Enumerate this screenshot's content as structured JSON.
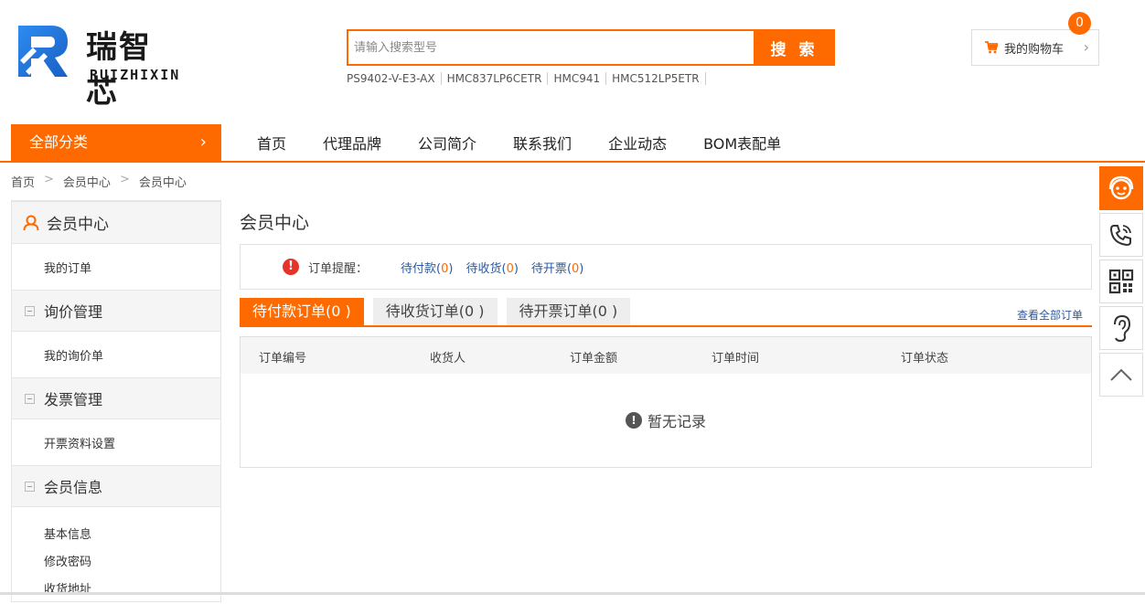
{
  "logo": {
    "cn": "瑞智芯",
    "en": "RUIZHIXIN"
  },
  "search": {
    "placeholder": "请输入搜索型号",
    "button": "搜 索"
  },
  "hot_parts": [
    "PS9402-V-E3-AX",
    "HMC837LP6CETR",
    "HMC941",
    "HMC512LP5ETR"
  ],
  "cart": {
    "label": "我的购物车",
    "count": "0"
  },
  "nav": {
    "all_categories": "全部分类",
    "links": [
      "首页",
      "代理品牌",
      "公司简介",
      "联系我们",
      "企业动态",
      "BOM表配单"
    ]
  },
  "breadcrumb": [
    "首页",
    "会员中心",
    "会员中心"
  ],
  "sidebar": {
    "title": "会员中心",
    "groups": [
      {
        "label": "",
        "links": [
          "我的订单"
        ]
      },
      {
        "label": "询价管理",
        "links": [
          "我的询价单"
        ]
      },
      {
        "label": "发票管理",
        "links": [
          "开票资料设置"
        ]
      },
      {
        "label": "会员信息",
        "links": [
          "基本信息",
          "修改密码",
          "收货地址"
        ]
      }
    ]
  },
  "main": {
    "title": "会员中心",
    "remind_label": "订单提醒：",
    "remind_items": [
      {
        "label": "待付款",
        "count": "0"
      },
      {
        "label": "待收货",
        "count": "0"
      },
      {
        "label": "待开票",
        "count": "0"
      }
    ],
    "tabs": [
      "待付款订单(0 )",
      "待收货订单(0 )",
      "待开票订单(0 )"
    ],
    "view_all": "查看全部订单",
    "columns": [
      "订单编号",
      "收货人",
      "订单金额",
      "订单时间",
      "订单状态"
    ],
    "empty_text": "暂无记录"
  },
  "colors": {
    "accent": "#ff6a00",
    "link": "#2b5aa0",
    "warning": "#e6332a"
  },
  "float_icons": [
    "customer-service-icon",
    "phone-icon",
    "qrcode-icon",
    "ear-icon",
    "back-to-top-icon"
  ]
}
